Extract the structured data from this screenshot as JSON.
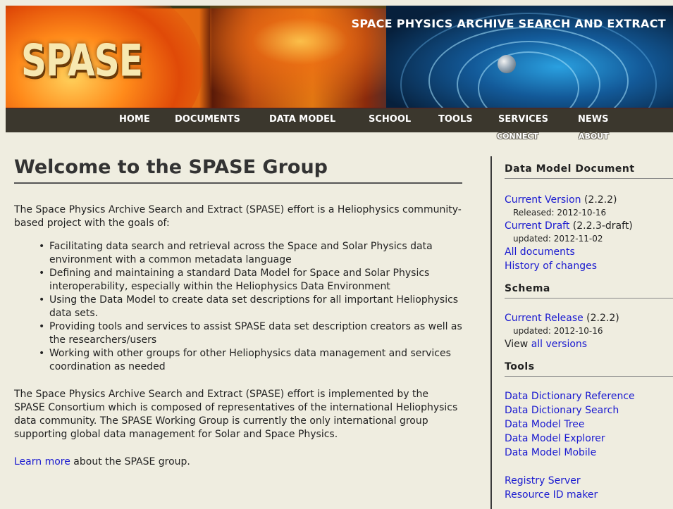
{
  "banner": {
    "logo": "SPASE",
    "tagline": "SPACE PHYSICS ARCHIVE SEARCH AND EXTRACT"
  },
  "nav": {
    "primary": [
      "HOME",
      "DOCUMENTS",
      "DATA MODEL",
      "SCHOOL",
      "TOOLS",
      "SERVICES",
      "NEWS"
    ],
    "secondary": [
      "CONNECT",
      "ABOUT"
    ]
  },
  "main": {
    "title": "Welcome to the SPASE Group",
    "intro": "The Space Physics Archive Search and Extract (SPASE) effort is a Heliophysics community-based project with the goals of:",
    "goals": [
      "Facilitating data search and retrieval across the Space and Solar Physics data environment with a common metadata language",
      "Defining and maintaining a standard Data Model for Space and Solar Physics interoperability, especially within the Heliophysics Data Environment",
      "Using the Data Model to create data set descriptions for all important Heliophysics data sets.",
      "Providing tools and services to assist SPASE data set description creators as well as the researchers/users",
      "Working with other groups for other Heliophysics data management and services coordination as needed"
    ],
    "consortium": "The Space Physics Archive Search and Extract (SPASE) effort is implemented by the SPASE Consortium which is composed of representatives of the international Heliophysics data community. The SPASE Working Group is currently the only international group supporting global data management for Solar and Space Physics.",
    "learn_link": "Learn more",
    "learn_rest": " about the SPASE group."
  },
  "sidebar": {
    "dm_heading": "Data Model Document",
    "current_version_link": "Current Version",
    "current_version_num": " (2.2.2)",
    "released": "Released: 2012-10-16",
    "current_draft_link": "Current Draft",
    "current_draft_num": " (2.2.3-draft)",
    "draft_updated": "updated: 2012-11-02",
    "all_documents": "All documents",
    "history": "History of changes",
    "schema_heading": "Schema",
    "current_release_link": "Current Release",
    "current_release_num": " (2.2.2)",
    "release_updated": "updated: 2012-10-16",
    "view_text": "View ",
    "all_versions": "all versions",
    "tools_heading": "Tools",
    "tools": [
      "Data Dictionary Reference",
      "Data Dictionary Search",
      "Data Model Tree",
      "Data Model Explorer",
      "Data Model Mobile"
    ],
    "tools2": [
      "Registry Server",
      "Resource ID maker"
    ]
  }
}
